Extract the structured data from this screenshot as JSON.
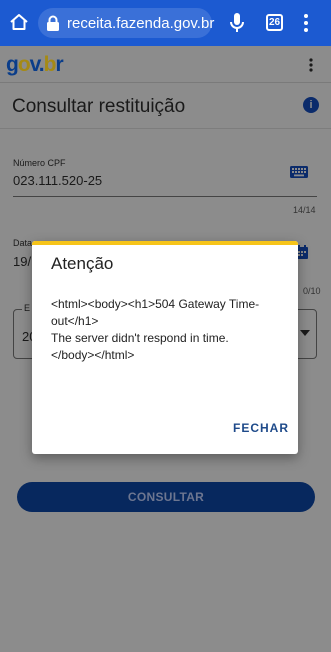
{
  "browser": {
    "url": "receita.fazenda.gov.br",
    "tabs_count": "26",
    "icons": [
      "home-icon",
      "lock-icon",
      "mic-icon",
      "kebab-icon"
    ],
    "bar_color": "#1c5ad1"
  },
  "header": {
    "logo": {
      "g": "g",
      "o": "o",
      "v": "v",
      "dot": ".",
      "b": "b",
      "r": "r"
    },
    "title": "Consultar restituição",
    "info_icon": "i"
  },
  "form": {
    "cpf": {
      "label": "Número CPF",
      "value": "023.111.520-25",
      "counter": "14/14"
    },
    "date": {
      "label": "Data",
      "value": "19/",
      "counter": "0/10"
    },
    "select": {
      "label": "E",
      "value": "20"
    },
    "submit_label": "CONSULTAR"
  },
  "dialog": {
    "title": "Atenção",
    "message_lines": [
      "<html><body><h1>504 Gateway Time-",
      "out</h1>",
      "The server didn't respond in time.",
      "</body></html>"
    ],
    "close_label": "FECHAR",
    "accent_color": "#f6c419"
  }
}
